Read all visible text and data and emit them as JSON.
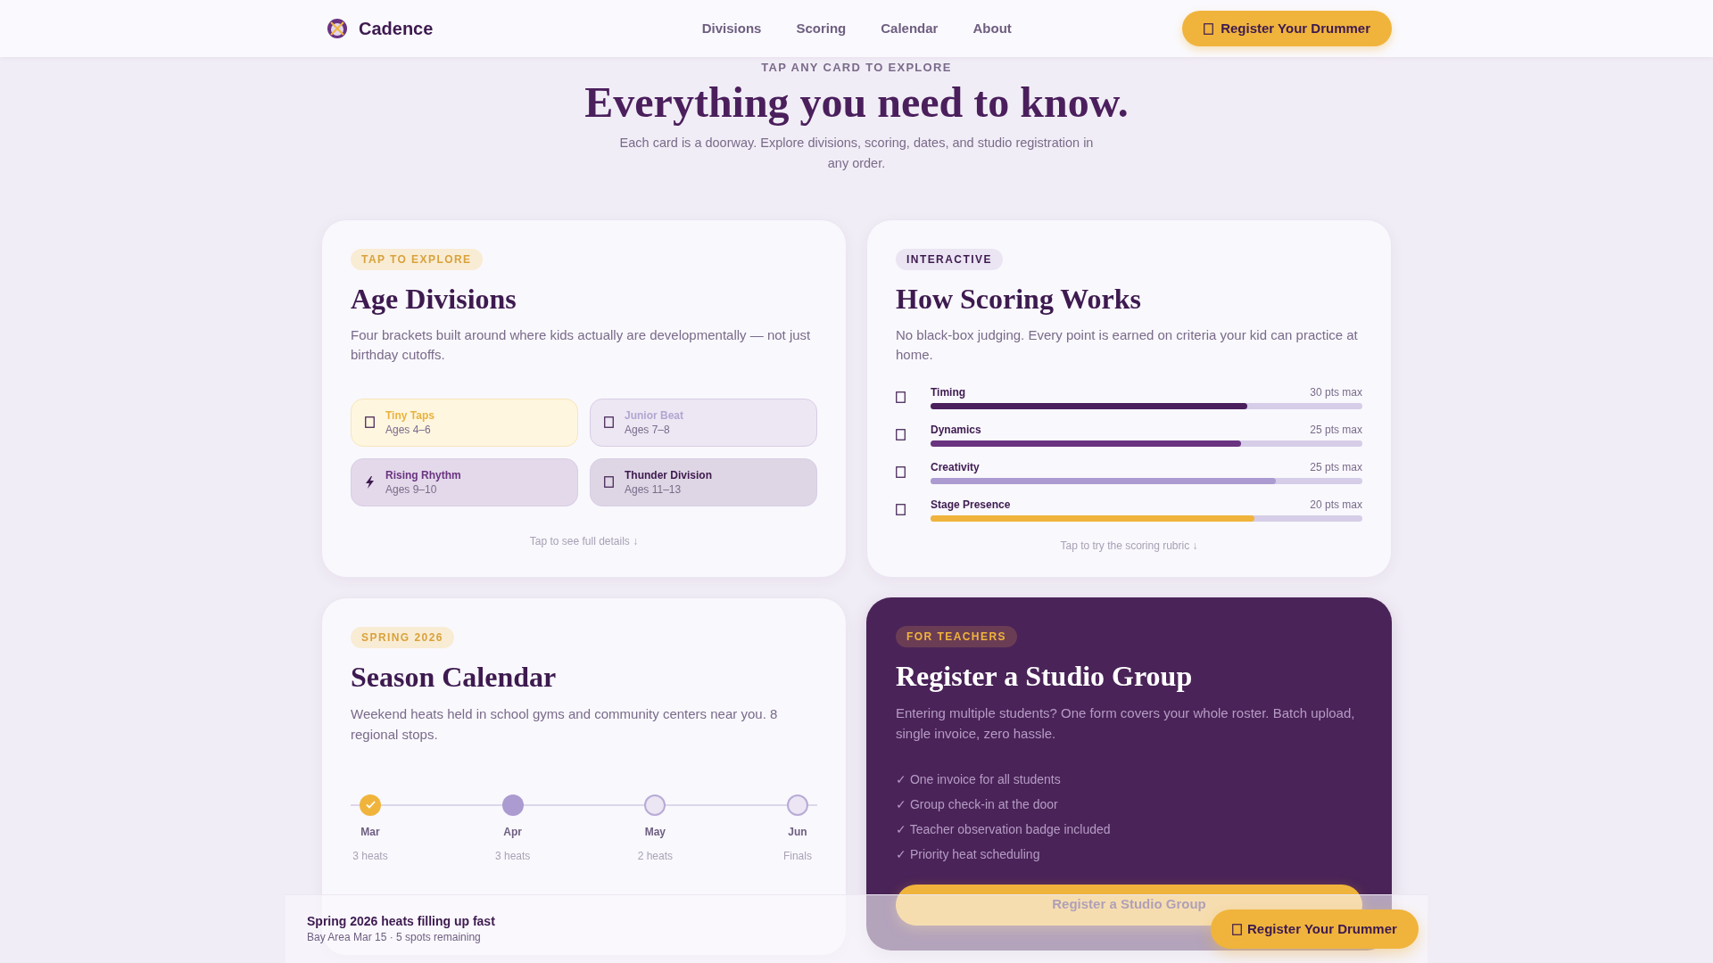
{
  "header": {
    "brand": "Cadence",
    "nav": [
      {
        "label": "Divisions"
      },
      {
        "label": "Scoring"
      },
      {
        "label": "Calendar"
      },
      {
        "label": "About"
      }
    ],
    "cta": "Register Your Drummer"
  },
  "hero": {
    "eyebrow": "TAP ANY CARD TO EXPLORE",
    "title": "Everything you need to know.",
    "subtitle": "Each card is a doorway. Explore divisions, scoring, dates, and studio registration in any order."
  },
  "divisions_card": {
    "tag": "TAP TO EXPLORE",
    "title": "Age Divisions",
    "description": "Four brackets built around where kids actually are developmentally — not just birthday cutoffs.",
    "hint": "Tap to see full details ↓",
    "divisions": [
      {
        "name": "Tiny Taps",
        "ages": "Ages 4–6",
        "kind": "box",
        "selected": true,
        "color": "#e8b33c"
      },
      {
        "name": "Junior Beat",
        "ages": "Ages 7–8",
        "kind": "box",
        "selected": false,
        "color": "#b3a6d1"
      },
      {
        "name": "Rising Rhythm",
        "ages": "Ages 9–10",
        "kind": "bolt",
        "selected": false,
        "color": "#6a3380"
      },
      {
        "name": "Thunder Division",
        "ages": "Ages 11–13",
        "kind": "box",
        "selected": false,
        "color": "#3d1a4f"
      }
    ]
  },
  "scoring_card": {
    "tag": "INTERACTIVE",
    "title": "How Scoring Works",
    "description": "No black-box judging. Every point is earned on criteria your kid can practice at home.",
    "hint": "Tap to try the scoring rubric ↓",
    "criteria": [
      {
        "name": "Timing",
        "max": "30 pts max",
        "level": 0.733,
        "color": "#4a1f5c"
      },
      {
        "name": "Dynamics",
        "max": "25 pts max",
        "level": 0.72,
        "color": "#6a3380"
      },
      {
        "name": "Creativity",
        "max": "25 pts max",
        "level": 0.8,
        "color": "#ab9bd0"
      },
      {
        "name": "Stage Presence",
        "max": "20 pts max",
        "level": 0.75,
        "color": "#f0b43c"
      }
    ]
  },
  "calendar_card": {
    "tag": "SPRING 2026",
    "title": "Season Calendar",
    "description": "Weekend heats held in school gyms and community centers near you. 8 regional stops.",
    "stops": [
      {
        "month": "Mar",
        "detail": "3 heats",
        "done": true,
        "selected": false
      },
      {
        "month": "Apr",
        "detail": "3 heats",
        "done": false,
        "selected": true
      },
      {
        "month": "May",
        "detail": "2 heats",
        "done": false,
        "selected": false
      },
      {
        "month": "Jun",
        "detail": "Finals",
        "done": false,
        "selected": false
      }
    ]
  },
  "studio_card": {
    "tag": "FOR TEACHERS",
    "title": "Register a Studio Group",
    "description": "Entering multiple students? One form covers your whole roster. Batch upload, single invoice, zero hassle.",
    "benefits": [
      "✓ One invoice for all students",
      "✓ Group check-in at the door",
      "✓ Teacher observation badge included",
      "✓ Priority heat scheduling"
    ],
    "button": "Register a Studio Group"
  },
  "bottom_bar": {
    "title": "Spring 2026 heats filling up fast",
    "subtitle": "Bay Area Mar 15 · 5 spots remaining",
    "button": "Register Your Drummer"
  }
}
